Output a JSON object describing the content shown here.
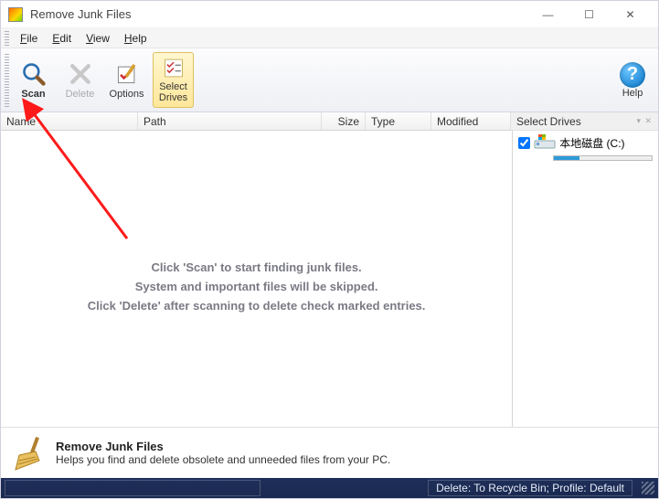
{
  "window": {
    "title": "Remove Junk Files",
    "min": "—",
    "max": "☐",
    "close": "✕"
  },
  "menu": {
    "items": [
      "File",
      "Edit",
      "View",
      "Help"
    ]
  },
  "toolbar": {
    "scan": "Scan",
    "delete": "Delete",
    "options": "Options",
    "select_drives_l1": "Select",
    "select_drives_l2": "Drives",
    "help": "Help",
    "help_symbol": "?"
  },
  "columns": {
    "name": "Name",
    "path": "Path",
    "size": "Size",
    "type": "Type",
    "modified": "Modified"
  },
  "side": {
    "header": "Select Drives",
    "drive_label": "本地磁盘 (C:)"
  },
  "empty": {
    "l1": "Click 'Scan' to start finding junk files.",
    "l2": "System and important files will be skipped.",
    "l3": "Click 'Delete' after scanning to delete check marked entries."
  },
  "footer": {
    "title": "Remove Junk Files",
    "desc": "Helps you find and delete obsolete and unneeded files from your PC."
  },
  "status": {
    "right": "Delete: To Recycle Bin; Profile: Default"
  }
}
